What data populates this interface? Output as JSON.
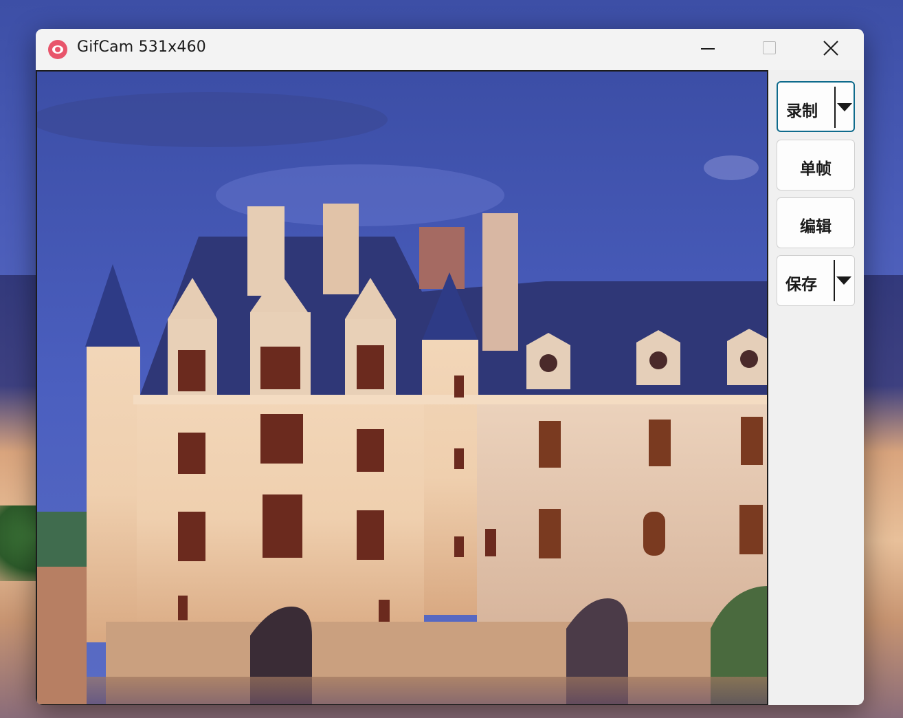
{
  "window": {
    "title": "GifCam 531x460"
  },
  "controls": {
    "minimize": "minimize",
    "maximize": "maximize",
    "close": "close"
  },
  "buttons": {
    "record": "录制",
    "frame": "单帧",
    "edit": "编辑",
    "save": "保存"
  },
  "colors": {
    "accent_border": "#0f6b8c",
    "app_icon": "#e8556b",
    "frame_border": "#1c1c1c"
  }
}
